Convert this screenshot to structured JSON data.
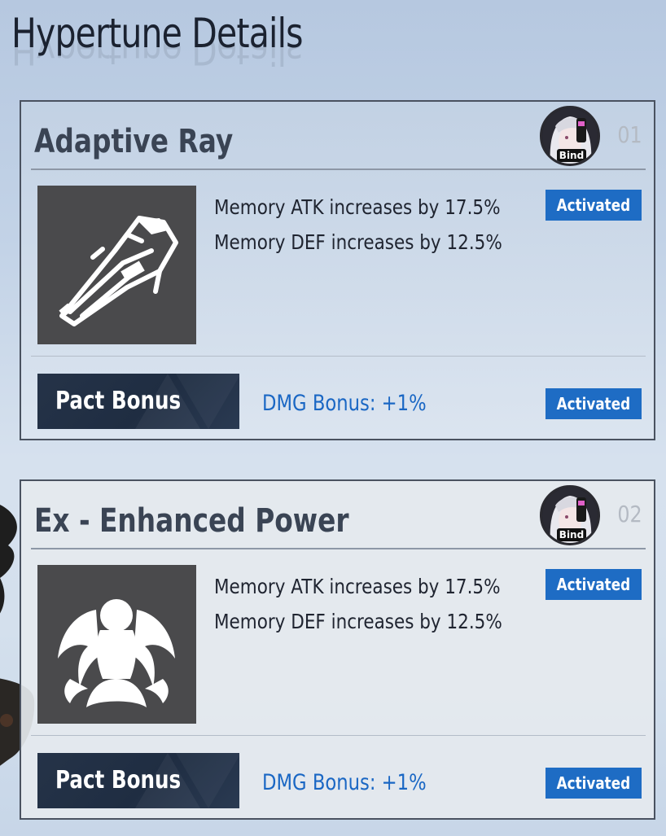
{
  "page": {
    "title": "Hypertune Details"
  },
  "cards": [
    {
      "name": "Adaptive Ray",
      "number": "01",
      "avatar_badge": "Bind",
      "icon": "adaptive-ray-icon",
      "effects": [
        "Memory ATK increases by 17.5%",
        "Memory DEF increases by 12.5%"
      ],
      "effects_status": "Activated",
      "pact_label": "Pact Bonus",
      "pact_bonus": "DMG Bonus: +1%",
      "pact_status": "Activated"
    },
    {
      "name": "Ex - Enhanced Power",
      "number": "02",
      "avatar_badge": "Bind",
      "icon": "enhanced-power-icon",
      "effects": [
        "Memory ATK increases by 17.5%",
        "Memory DEF increases by 12.5%"
      ],
      "effects_status": "Activated",
      "pact_label": "Pact Bonus",
      "pact_bonus": "DMG Bonus: +1%",
      "pact_status": "Activated"
    }
  ],
  "colors": {
    "status_badge": "#1e6cc4",
    "bonus_text": "#1a67c4",
    "pact_button": "#253348",
    "icon_background": "#4a4a4c"
  }
}
